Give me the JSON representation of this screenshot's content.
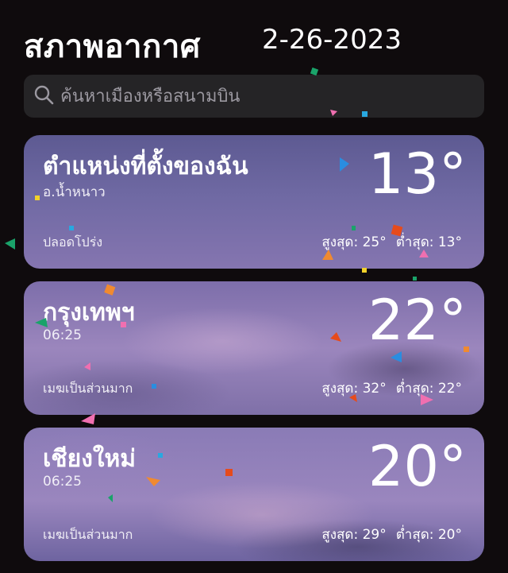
{
  "header": {
    "title": "สภาพอากาศ",
    "date": "2-26-2023"
  },
  "search": {
    "placeholder": "ค้นหาเมืองหรือสนามบิน",
    "value": ""
  },
  "cards": [
    {
      "city": "ตำแหน่งที่ตั้งของฉัน",
      "subtitle": "อ.น้ำหนาว",
      "temp": "13°",
      "condition": "ปลอดโปร่ง",
      "high": "สูงสุด: 25°",
      "low": "ต่ำสุด: 13°"
    },
    {
      "city": "กรุงเทพฯ",
      "subtitle": "06:25",
      "temp": "22°",
      "condition": "เมฆเป็นส่วนมาก",
      "high": "สูงสุด: 32°",
      "low": "ต่ำสุด: 22°"
    },
    {
      "city": "เชียงใหม่",
      "subtitle": "06:25",
      "temp": "20°",
      "condition": "เมฆเป็นส่วนมาก",
      "high": "สูงสุด: 29°",
      "low": "ต่ำสุด: 20°"
    }
  ],
  "colors": {
    "background": "#0f0b0d",
    "search_bg": "#252426",
    "card1": "#6a66a0",
    "card2": "#8f7db6",
    "card3": "#8a7bb6"
  },
  "icons": {
    "search": "search-icon"
  }
}
